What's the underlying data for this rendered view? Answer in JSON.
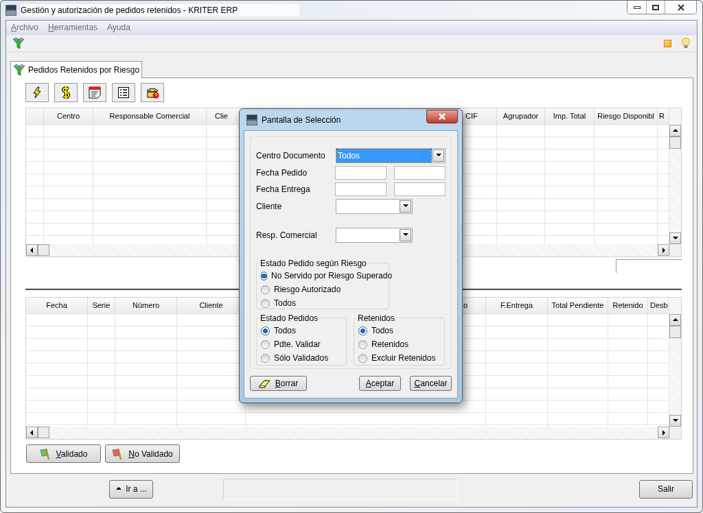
{
  "window": {
    "title": "Gestión y autorización de pedidos retenidos - KRITER ERP"
  },
  "menu": [
    {
      "label": "Archivo",
      "underline_first": true
    },
    {
      "label": "Herramientas",
      "underline_first": true
    },
    {
      "label": "Ayuda",
      "underline_first": false
    }
  ],
  "tabs": [
    {
      "label": "Pedidos Retenidos por Riesgo",
      "selected": true
    }
  ],
  "tool_buttons": [
    {
      "kind": "lightning"
    },
    {
      "kind": "dollar"
    },
    {
      "kind": "calendar"
    },
    {
      "kind": "list"
    },
    {
      "kind": "phone"
    }
  ],
  "top_grid": {
    "columns": [
      "",
      "Centro",
      "Responsable Comercial",
      "Clie",
      "CIF",
      "Agrupador",
      "Imp. Total",
      "Riesgo Disponibl",
      "R"
    ]
  },
  "bottom_grid": {
    "columns": [
      "Fecha",
      "Serie",
      "Número",
      "Cliente",
      "o",
      "F.Entrega",
      "Total Pendiente",
      "Retenido",
      "Desb"
    ]
  },
  "action_buttons": [
    {
      "label": "Validado",
      "underline_first": true,
      "kind": "green_flag"
    },
    {
      "label": "No Validado",
      "underline_first": true,
      "kind": "red_flag"
    }
  ],
  "footer": {
    "goto_button": "Ir a ...",
    "exit_button": "Salir"
  },
  "dialog": {
    "title": "Pantalla de Selección",
    "fields": [
      {
        "label": "Centro Documento",
        "kind": "combo",
        "value": "Todos",
        "focused": true
      },
      {
        "label": "Fecha Pedido",
        "kind": "range"
      },
      {
        "label": "Fecha Entrega",
        "kind": "range"
      },
      {
        "label": "Cliente",
        "kind": "combo",
        "focused": false
      },
      {
        "label": "Resp. Comercial",
        "kind": "combo",
        "focused": false
      }
    ],
    "groups": [
      {
        "title": "Estado Pedido según Riesgo",
        "options": [
          {
            "label": "No Servido por Riesgo Superado",
            "selected": true
          },
          {
            "label": "Riesgo Autorizado",
            "selected": false
          },
          {
            "label": "Todos",
            "selected": false
          }
        ]
      },
      {
        "title": "Estado Pedidos",
        "options": [
          {
            "label": "Todos",
            "selected": true
          },
          {
            "label": "Pdte. Validar",
            "selected": false
          },
          {
            "label": "Sólo Validados",
            "selected": false
          }
        ]
      },
      {
        "title": "Retenidos",
        "options": [
          {
            "label": "Todos",
            "selected": true
          },
          {
            "label": "Retenidos",
            "selected": false
          },
          {
            "label": "Excluir Retenidos",
            "selected": false
          }
        ]
      }
    ],
    "buttons": [
      {
        "label": "Borrar",
        "underline_first": true,
        "kind": "eraser"
      },
      {
        "label": "Aceptar",
        "underline_first": true,
        "kind": "plain"
      },
      {
        "label": "Cancelar",
        "underline_first": true,
        "kind": "plain"
      }
    ]
  }
}
